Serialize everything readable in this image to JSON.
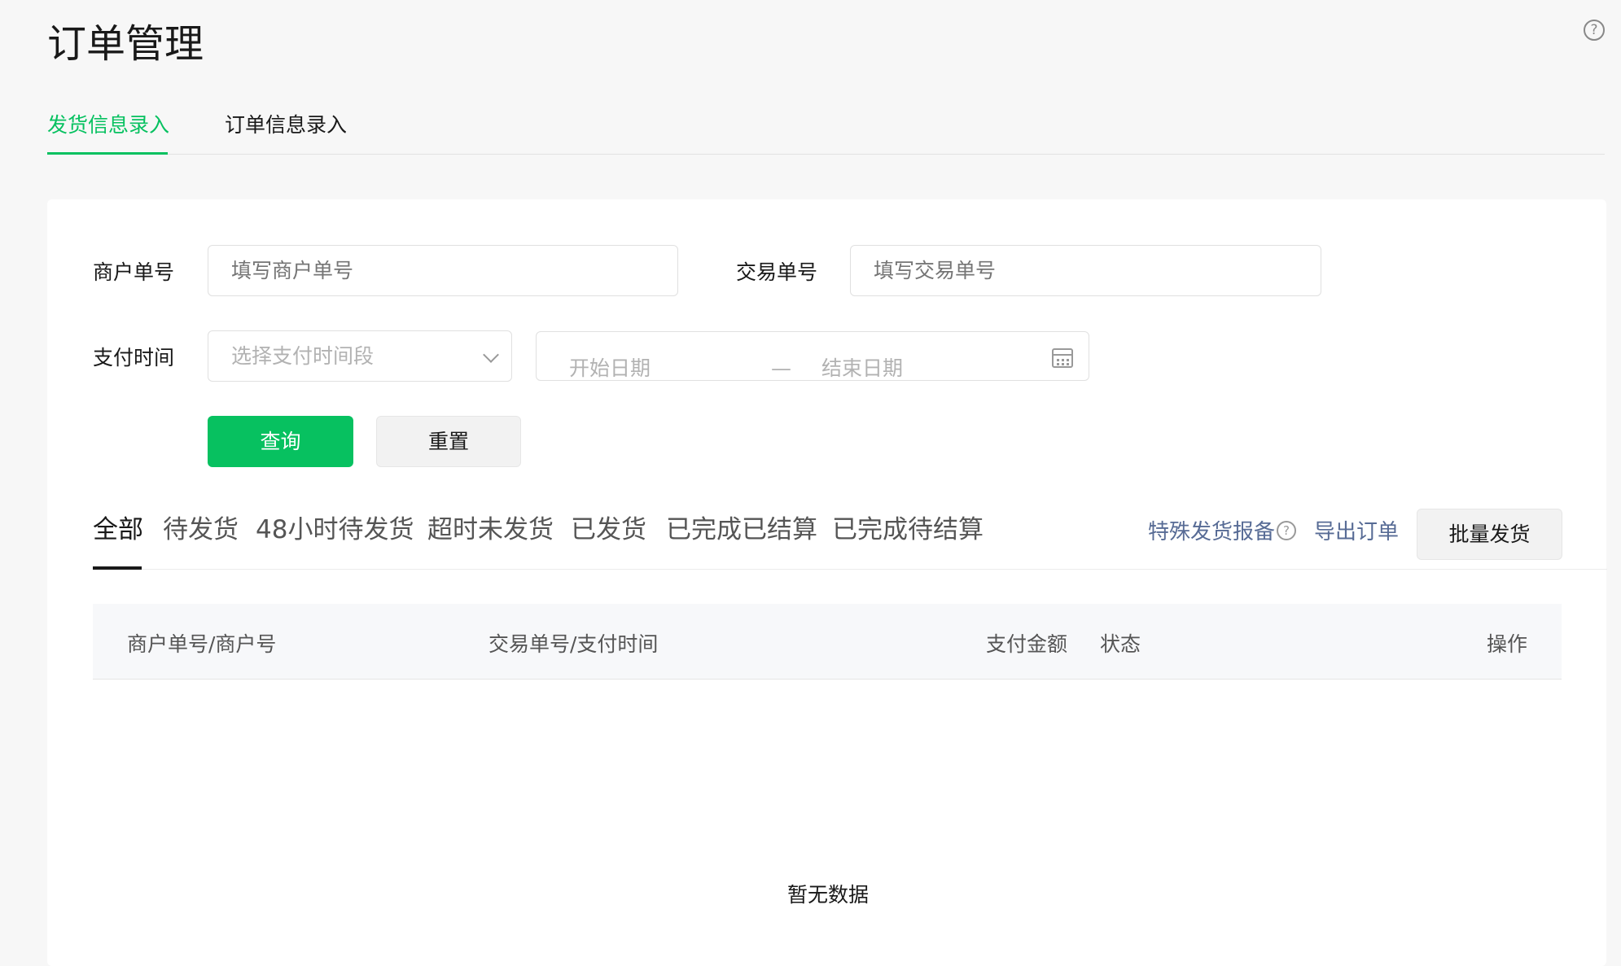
{
  "header": {
    "title": "订单管理",
    "help_icon": "question-circle-icon",
    "help_symbol": "?"
  },
  "tabs": [
    {
      "label": "发货信息录入",
      "active": true
    },
    {
      "label": "订单信息录入",
      "active": false
    }
  ],
  "form": {
    "merchant_no_label": "商户单号",
    "merchant_no_placeholder": "填写商户单号",
    "merchant_no_value": "",
    "trade_no_label": "交易单号",
    "trade_no_placeholder": "填写交易单号",
    "trade_no_value": "",
    "pay_time_label": "支付时间",
    "pay_time_select_placeholder": "选择支付时间段",
    "start_date_placeholder": "开始日期",
    "range_separator": "—",
    "end_date_placeholder": "结束日期",
    "query_button": "查询",
    "reset_button": "重置"
  },
  "filter_tabs": [
    {
      "label": "全部",
      "active": true
    },
    {
      "label": "待发货",
      "active": false
    },
    {
      "label": "48小时待发货",
      "active": false
    },
    {
      "label": "超时未发货",
      "active": false
    },
    {
      "label": "已发货",
      "active": false
    },
    {
      "label": "已完成已结算",
      "active": false
    },
    {
      "label": "已完成待结算",
      "active": false
    }
  ],
  "actions": {
    "special_report_link": "特殊发货报备",
    "special_report_help_symbol": "?",
    "export_link": "导出订单",
    "batch_ship_button": "批量发货"
  },
  "table": {
    "columns": [
      "商户单号/商户号",
      "交易单号/支付时间",
      "支付金额",
      "状态",
      "操作"
    ],
    "rows": [],
    "empty_text": "暂无数据"
  },
  "colors": {
    "accent": "#07c160",
    "link": "#576b95",
    "page_bg": "#f7f7f7",
    "card_bg": "#ffffff"
  }
}
